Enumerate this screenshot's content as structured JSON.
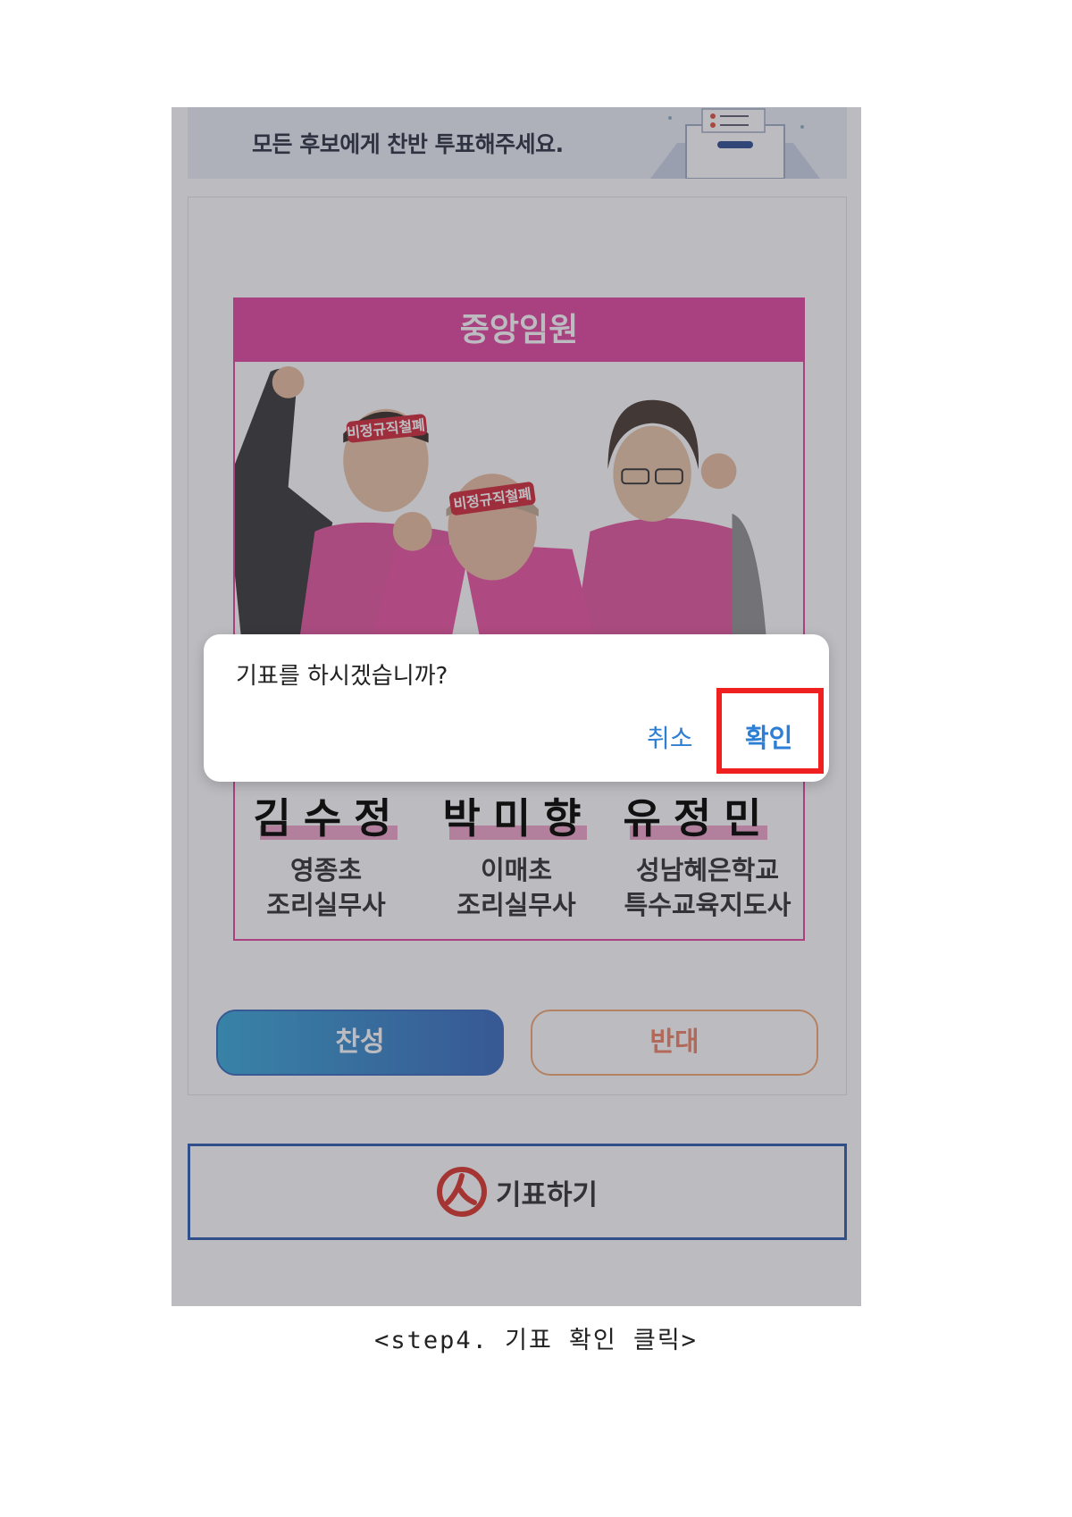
{
  "banner": {
    "text": "모든 후보에게 찬반 투표해주세요."
  },
  "panel": {
    "title": "중앙임원",
    "headband_text": "비정규직철폐"
  },
  "candidates": [
    {
      "name": "김수정",
      "school": "영종초",
      "role": "조리실무사"
    },
    {
      "name": "박미향",
      "school": "이매초",
      "role": "조리실무사"
    },
    {
      "name": "유정민",
      "school": "성남혜은학교",
      "role": "특수교육지도사"
    }
  ],
  "vote": {
    "yes_label": "찬성",
    "no_label": "반대"
  },
  "submit": {
    "label": "기표하기"
  },
  "dialog": {
    "message": "기표를 하시겠습니까?",
    "cancel_label": "취소",
    "ok_label": "확인"
  },
  "caption": "<step4. 기표 확인 클릭>",
  "colors": {
    "brand_pink": "#e0399a",
    "accent_blue": "#2c7fd4",
    "highlight_red": "#ee2020",
    "submit_border": "#1f4fa8"
  }
}
